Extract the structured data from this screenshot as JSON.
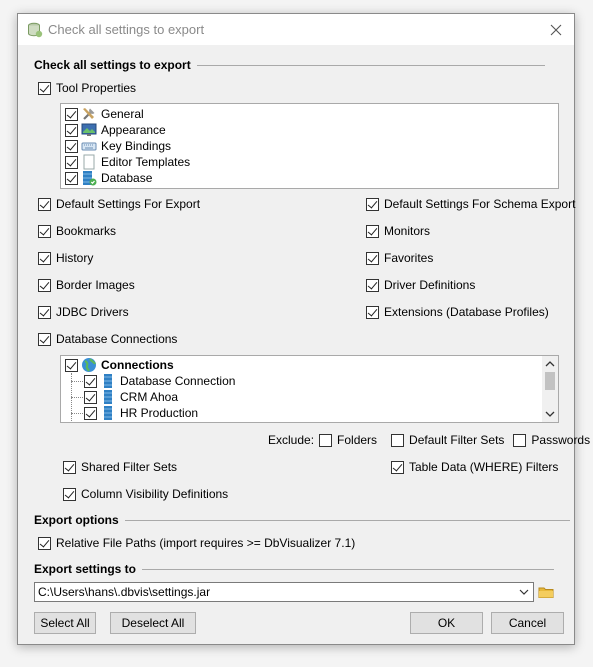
{
  "window": {
    "title": "Check all settings to export"
  },
  "sections": {
    "check_all": "Check all settings to export",
    "export_options": "Export options",
    "export_to": "Export settings to"
  },
  "tool_properties": {
    "label": "Tool Properties",
    "checked": true,
    "items": [
      {
        "label": "General",
        "icon": "tools-icon"
      },
      {
        "label": "Appearance",
        "icon": "appearance-icon"
      },
      {
        "label": "Key Bindings",
        "icon": "keyboard-icon"
      },
      {
        "label": "Editor Templates",
        "icon": "template-icon"
      },
      {
        "label": "Database",
        "icon": "database-icon"
      }
    ]
  },
  "left_options": [
    {
      "label": "Default Settings For Export",
      "checked": true
    },
    {
      "label": "Bookmarks",
      "checked": true
    },
    {
      "label": "History",
      "checked": true
    },
    {
      "label": "Border Images",
      "checked": true
    },
    {
      "label": "JDBC Drivers",
      "checked": true
    },
    {
      "label": "Database Connections",
      "checked": true
    }
  ],
  "right_options": [
    {
      "label": "Default Settings For Schema Export",
      "checked": true
    },
    {
      "label": "Monitors",
      "checked": true
    },
    {
      "label": "Favorites",
      "checked": true
    },
    {
      "label": "Driver Definitions",
      "checked": true
    },
    {
      "label": "Extensions (Database Profiles)",
      "checked": true
    }
  ],
  "connections": {
    "root": "Connections",
    "items": [
      "Database Connection",
      "CRM Ahoa",
      "HR Production"
    ]
  },
  "exclude": {
    "label": "Exclude:",
    "options": [
      {
        "label": "Folders",
        "checked": false
      },
      {
        "label": "Default Filter Sets",
        "checked": false
      },
      {
        "label": "Passwords",
        "checked": false
      }
    ]
  },
  "filters": {
    "shared": {
      "label": "Shared Filter Sets",
      "checked": true
    },
    "table_data": {
      "label": "Table Data (WHERE) Filters",
      "checked": true
    },
    "column_visibility": {
      "label": "Column Visibility Definitions",
      "checked": true
    }
  },
  "export_options": {
    "relative_paths": {
      "label": "Relative File Paths (import requires >= DbVisualizer 7.1)",
      "checked": true
    }
  },
  "export_path": {
    "value": "C:\\Users\\hans\\.dbvis\\settings.jar"
  },
  "buttons": {
    "select_all": "Select All",
    "deselect_all": "Deselect All",
    "ok": "OK",
    "cancel": "Cancel"
  },
  "colors": {
    "accent_green": "#4caf50",
    "folder_yellow": "#e8b93b"
  }
}
